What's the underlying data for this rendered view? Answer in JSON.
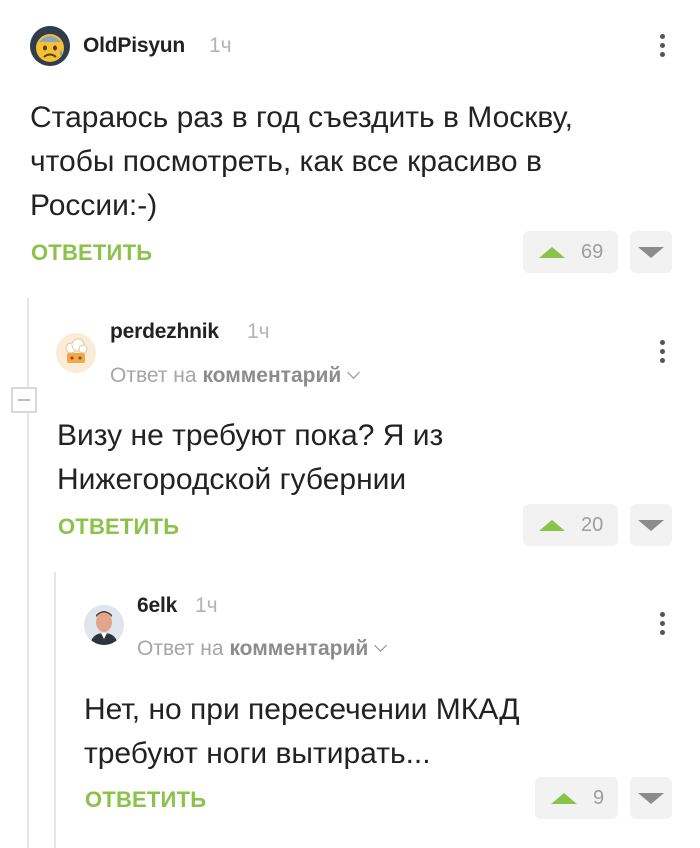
{
  "comments": [
    {
      "author": "OldPisyun",
      "time": "1ч",
      "text": "Стараюсь раз в год съездить в Москву, чтобы посмотреть, как все красиво в России:-)",
      "reply_label": "ОТВЕТИТЬ",
      "votes": "69",
      "avatar_icon": "crying-face-icon"
    },
    {
      "author": "perdezhnik",
      "time": "1ч",
      "reply_to_prefix": "Ответ на",
      "reply_to_link": "комментарий",
      "text": "Визу не требуют пока? Я из Нижегородской губернии",
      "reply_label": "ОТВЕТИТЬ",
      "votes": "20",
      "avatar_icon": "chef-hat-icon"
    },
    {
      "author": "6elk",
      "time": "1ч",
      "reply_to_prefix": "Ответ на",
      "reply_to_link": "комментарий",
      "text": "Нет, но при пересечении МКАД требуют ноги вытирать...",
      "reply_label": "ОТВЕТИТЬ",
      "votes": "9",
      "avatar_icon": "man-portrait-icon"
    }
  ],
  "colors": {
    "accent": "#8bc34a",
    "muted": "#a6a6a6",
    "vote_bg": "#f2f2f2"
  }
}
